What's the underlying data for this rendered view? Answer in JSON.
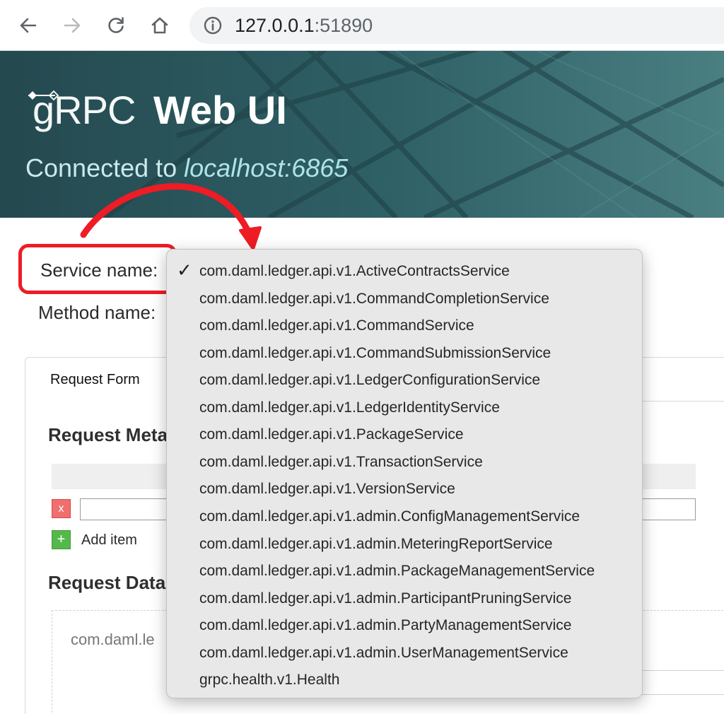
{
  "browser": {
    "url_host": "127.0.0.1",
    "url_port": ":51890"
  },
  "header": {
    "logo_text": "gRPC",
    "app_name": "Web UI",
    "connected_prefix": "Connected to ",
    "connected_host": "localhost:6865"
  },
  "form": {
    "service_label": "Service name:",
    "method_label": "Method name:"
  },
  "panel": {
    "tab_label": "Request Form",
    "metadata_title": "Request Meta",
    "remove_label": "x",
    "add_symbol": "+",
    "add_label": "Add item",
    "data_title": "Request Data",
    "data_placeholder": "com.daml.le"
  },
  "dropdown": {
    "check_glyph": "✓",
    "selected": "com.daml.ledger.api.v1.ActiveContractsService",
    "items": [
      {
        "label": "com.daml.ledger.api.v1.ActiveContractsService",
        "checked": true
      },
      {
        "label": "com.daml.ledger.api.v1.CommandCompletionService",
        "checked": false
      },
      {
        "label": "com.daml.ledger.api.v1.CommandService",
        "checked": false
      },
      {
        "label": "com.daml.ledger.api.v1.CommandSubmissionService",
        "checked": false
      },
      {
        "label": "com.daml.ledger.api.v1.LedgerConfigurationService",
        "checked": false
      },
      {
        "label": "com.daml.ledger.api.v1.LedgerIdentityService",
        "checked": false
      },
      {
        "label": "com.daml.ledger.api.v1.PackageService",
        "checked": false
      },
      {
        "label": "com.daml.ledger.api.v1.TransactionService",
        "checked": false
      },
      {
        "label": "com.daml.ledger.api.v1.VersionService",
        "checked": false
      },
      {
        "label": "com.daml.ledger.api.v1.admin.ConfigManagementService",
        "checked": false
      },
      {
        "label": "com.daml.ledger.api.v1.admin.MeteringReportService",
        "checked": false
      },
      {
        "label": "com.daml.ledger.api.v1.admin.PackageManagementService",
        "checked": false
      },
      {
        "label": "com.daml.ledger.api.v1.admin.ParticipantPruningService",
        "checked": false
      },
      {
        "label": "com.daml.ledger.api.v1.admin.PartyManagementService",
        "checked": false
      },
      {
        "label": "com.daml.ledger.api.v1.admin.UserManagementService",
        "checked": false
      },
      {
        "label": "grpc.health.v1.Health",
        "checked": false
      }
    ]
  },
  "colors": {
    "header_bg": "#2b5a60",
    "annotation_red": "#ee1c25",
    "remove_red": "#ef6f6f",
    "add_green": "#55b84a"
  },
  "icons": [
    "back-arrow-icon",
    "forward-arrow-icon",
    "reload-icon",
    "home-icon",
    "info-icon",
    "checkmark-icon"
  ]
}
